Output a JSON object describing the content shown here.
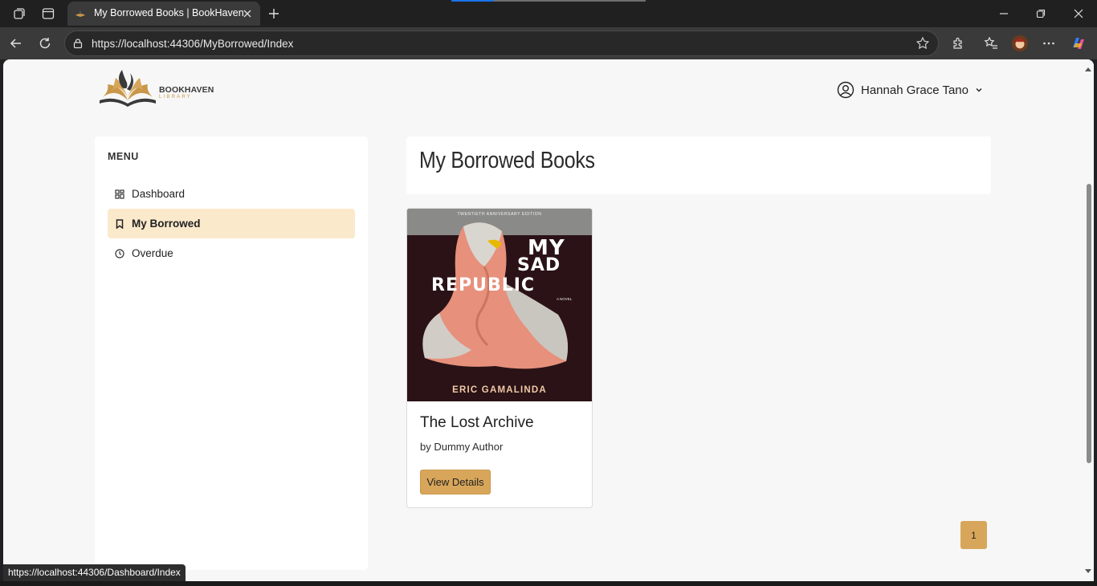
{
  "browser": {
    "tab_title": "My Borrowed Books | BookHaven",
    "url": "https://localhost:44306/MyBorrowed/Index",
    "status_url": "https://localhost:44306/Dashboard/Index",
    "page_load_progress": 0.22
  },
  "brand": {
    "name": "BOOKHAVEN",
    "sub": "LIBRARY",
    "colors": {
      "accent": "#d8a65a",
      "active_bg": "#fbe9cb"
    }
  },
  "user": {
    "name": "Hannah Grace Tano"
  },
  "sidebar": {
    "title": "MENU",
    "items": [
      {
        "label": "Dashboard",
        "icon": "dashboard-icon",
        "active": false
      },
      {
        "label": "My Borrowed",
        "icon": "bookmark-icon",
        "active": true
      },
      {
        "label": "Overdue",
        "icon": "clock-icon",
        "active": false
      }
    ]
  },
  "main": {
    "title": "My Borrowed Books",
    "books": [
      {
        "title": "The Lost Archive",
        "author": "by Dummy Author",
        "button": "View Details",
        "cover": {
          "edition": "TWENTIETH ANNIVERSARY EDITION",
          "title_lines": [
            "MY",
            "SAD",
            "REPUBLIC"
          ],
          "subtitle": "A NOVEL",
          "author": "ERIC GAMALINDA"
        }
      }
    ],
    "pagination": {
      "current": "1"
    }
  }
}
